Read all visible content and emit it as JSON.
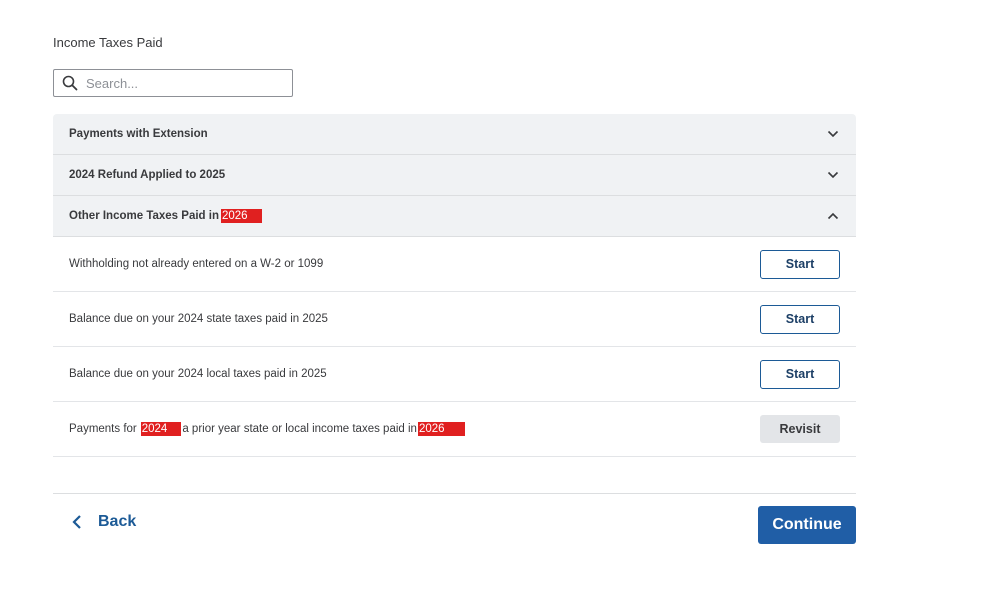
{
  "page": {
    "title": "Income Taxes Paid"
  },
  "search": {
    "placeholder": "Search..."
  },
  "sections": [
    {
      "label": "Payments with Extension",
      "expanded": false
    },
    {
      "label": "2024 Refund Applied to 2025",
      "expanded": false
    },
    {
      "label": "Other Income Taxes Paid in",
      "redacted_text": "2026",
      "expanded": true
    }
  ],
  "rows": [
    {
      "text": "Withholding not already entered on a W-2 or 1099",
      "action": "Start"
    },
    {
      "text": "Balance due on your 2024 state taxes paid in 2025",
      "action": "Start"
    },
    {
      "text": "Balance due on your 2024 local taxes paid in 2025",
      "action": "Start"
    },
    {
      "text_prefix": "Payments for",
      "redacted_1": "2024",
      "text_middle": "a prior year state or local income taxes paid in",
      "redacted_2": "2026",
      "action": "Revisit"
    }
  ],
  "footer": {
    "back_label": "Back",
    "continue_label": "Continue"
  },
  "colors": {
    "primary": "#205ea6",
    "redaction": "#e02020",
    "header_bg": "#f0f2f4"
  }
}
